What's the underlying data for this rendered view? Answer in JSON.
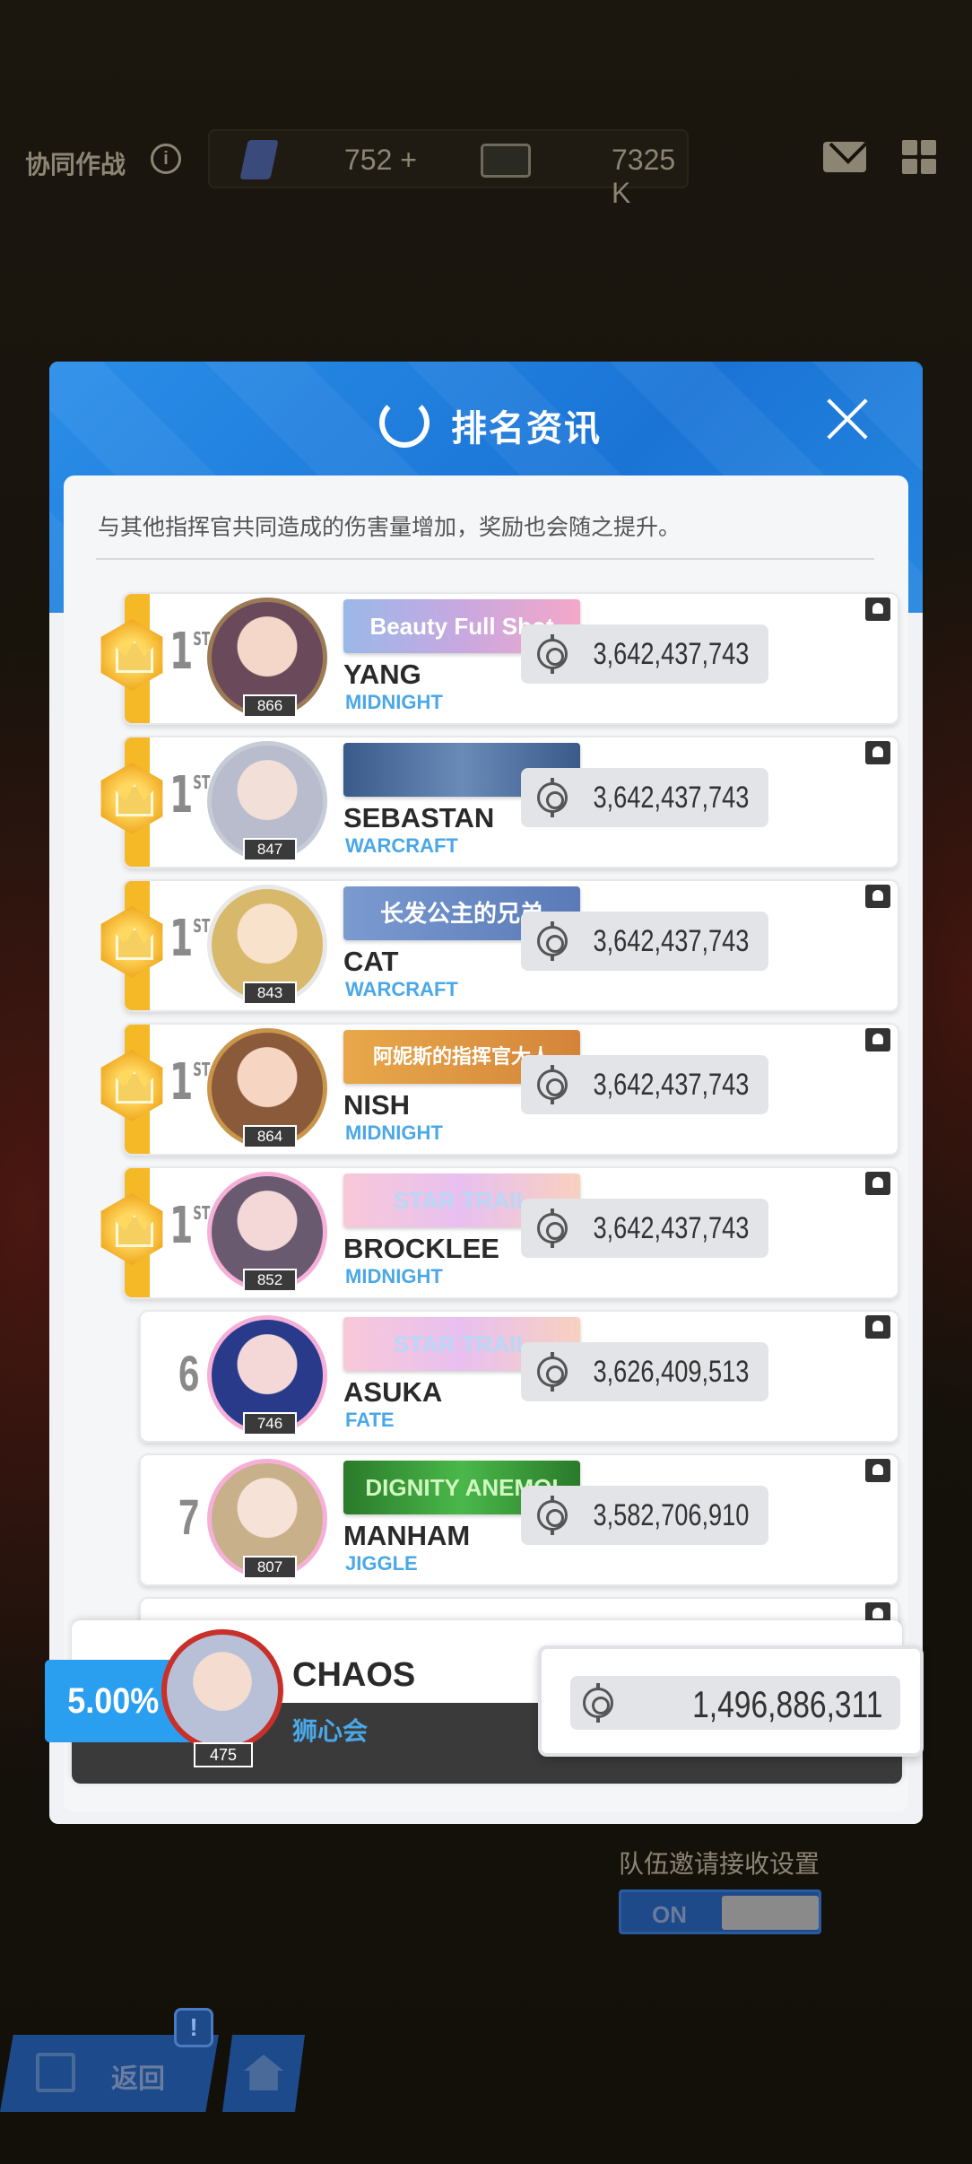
{
  "topbar": {
    "title": "协同作战",
    "info_icon": "i",
    "gem_value": "752 +",
    "ticket_value": "7325 K",
    "icons": [
      "info-icon",
      "gem-icon",
      "ticket-icon",
      "mail-icon",
      "grid-menu-icon"
    ]
  },
  "modal": {
    "title": "排名资讯",
    "description": "与其他指挥官共同造成的伤害量增加，奖励也会随之提升。",
    "icons": [
      "laurel-icon",
      "close-icon"
    ],
    "rows": [
      {
        "rank": "1",
        "suffix": "ST",
        "level": "866",
        "banner": "Beauty Full Shot",
        "name": "YANG",
        "guild": "MIDNIGHT",
        "score": "3,642,437,743"
      },
      {
        "rank": "1",
        "suffix": "ST",
        "level": "847",
        "banner": "",
        "name": "SEBASTAN",
        "guild": "WARCRAFT",
        "score": "3,642,437,743"
      },
      {
        "rank": "1",
        "suffix": "ST",
        "level": "843",
        "banner": "长发公主的兄弟",
        "name": "CAT",
        "guild": "WARCRAFT",
        "score": "3,642,437,743"
      },
      {
        "rank": "1",
        "suffix": "ST",
        "level": "864",
        "banner": "阿妮斯的指挥官大人",
        "name": "NISH",
        "guild": "MIDNIGHT",
        "score": "3,642,437,743"
      },
      {
        "rank": "1",
        "suffix": "ST",
        "level": "852",
        "banner": "STAR TRAIL",
        "name": "BROCKLEE",
        "guild": "MIDNIGHT",
        "score": "3,642,437,743"
      },
      {
        "rank": "6",
        "suffix": "",
        "level": "746",
        "banner": "STAR TRAIL",
        "name": "ASUKA",
        "guild": "FATE",
        "score": "3,626,409,513"
      },
      {
        "rank": "7",
        "suffix": "",
        "level": "807",
        "banner": "DIGNITY ANEMOI",
        "name": "MANHAM",
        "guild": "JIGGLE",
        "score": "3,582,706,910"
      }
    ],
    "self": {
      "percent": "5.00%",
      "level": "475",
      "name": "CHAOS",
      "guild": "狮心会",
      "score": "1,496,886,311"
    }
  },
  "invite": {
    "label": "队伍邀请接收设置",
    "toggle_label": "ON"
  },
  "nav": {
    "back_label": "返回",
    "badge": "!"
  },
  "colors": {
    "accent_blue": "#1a74d6",
    "gold": "#f5b928",
    "guild_blue": "#4aa8e8",
    "self_percent_bg": "#2a9ff0"
  }
}
